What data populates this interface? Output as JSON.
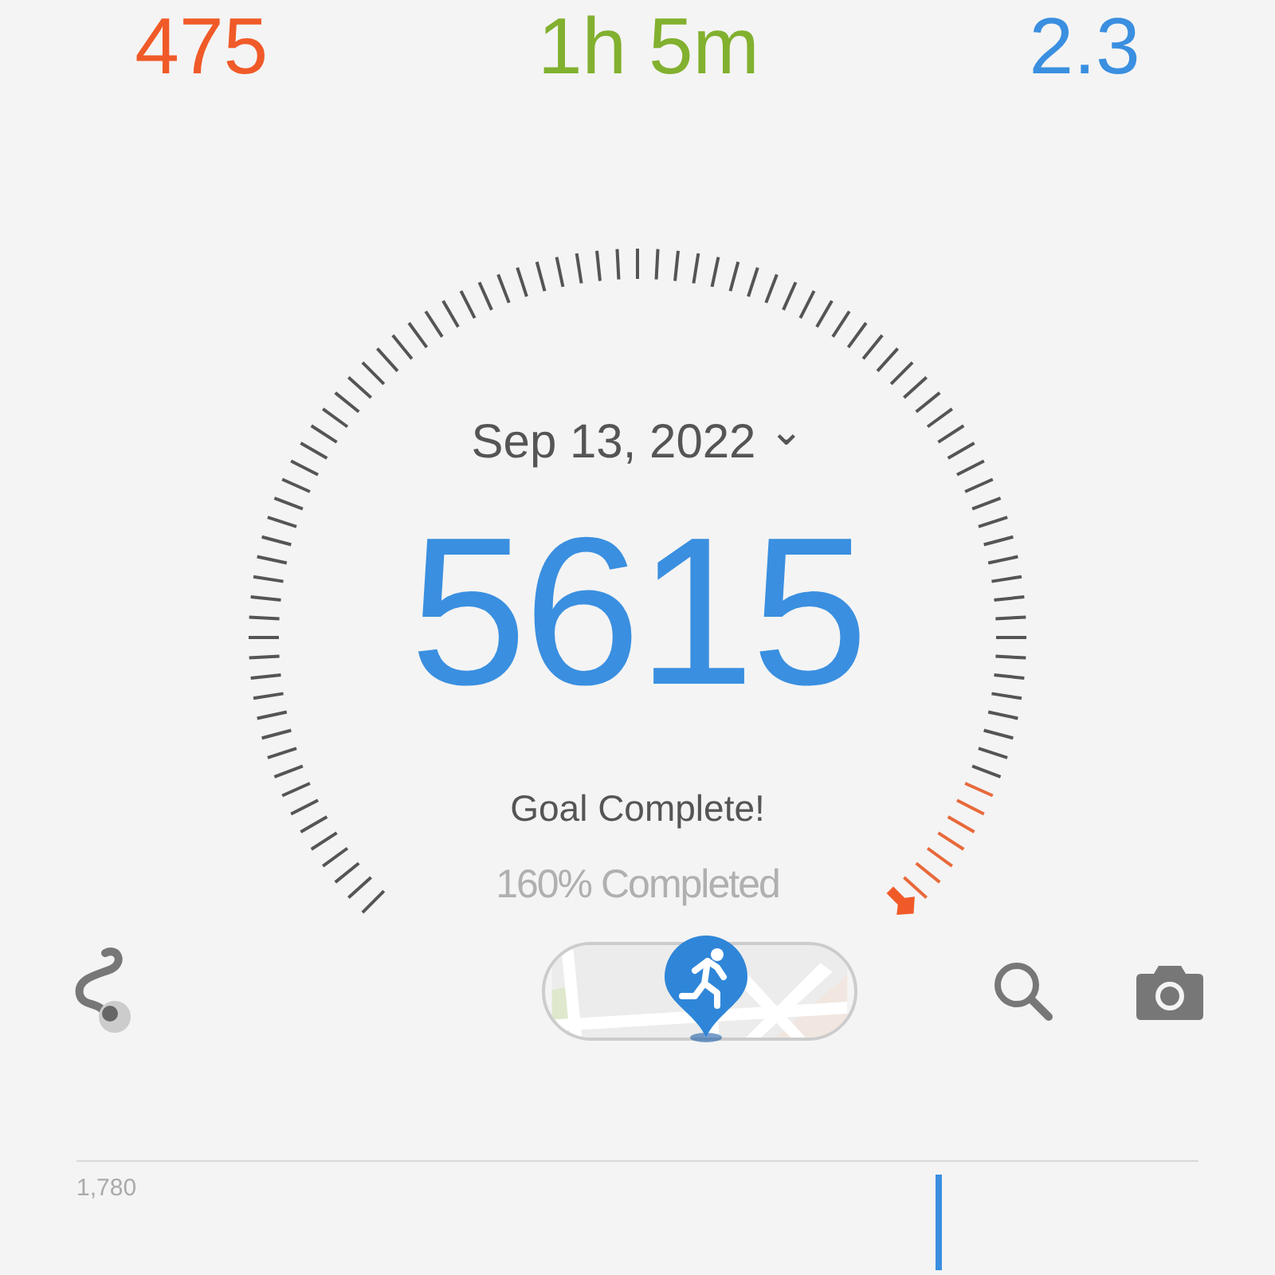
{
  "stats": [
    {
      "value": "475",
      "color": "#f05a28"
    },
    {
      "value": "1h 5m",
      "color": "#82b02f"
    },
    {
      "value": "2.3",
      "color": "#3a8fe0"
    }
  ],
  "gauge": {
    "date": "Sep 13, 2022",
    "dropdown": "⌄",
    "steps": "5615",
    "status": "Goal Complete!",
    "percent": "160% Completed"
  },
  "chart": {
    "max_label": "1,780"
  }
}
